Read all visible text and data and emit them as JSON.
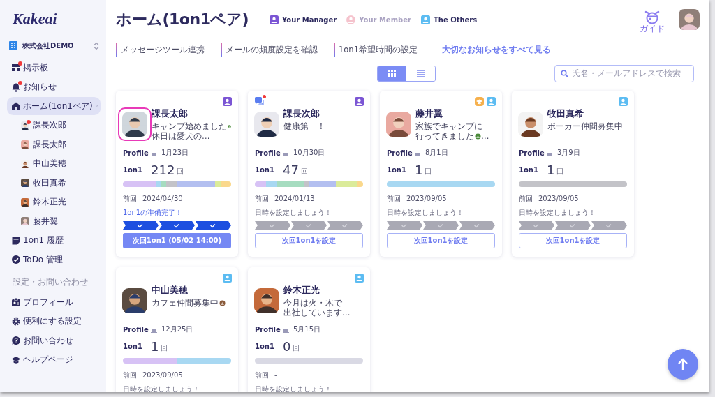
{
  "sidebar": {
    "logo": "Kakeai",
    "company": "株式会社DEMO",
    "items": [
      {
        "kind": "board",
        "label": "掲示板",
        "unread": true,
        "selected": false
      },
      {
        "kind": "bell",
        "label": "お知らせ",
        "unread": true,
        "selected": false
      },
      {
        "kind": "home",
        "label": "ホーム(1on1ペア)",
        "unread": false,
        "selected": true,
        "expanded": true,
        "children": [
          {
            "label": "課長次郎",
            "unread": true,
            "selected": false
          },
          {
            "label": "課長太郎",
            "unread": false,
            "selected": false
          },
          {
            "label": "中山美穂",
            "unread": false,
            "selected": false
          },
          {
            "label": "牧田真希",
            "unread": false,
            "selected": false
          },
          {
            "label": "鈴木正光",
            "unread": false,
            "selected": false
          },
          {
            "label": "藤井翼",
            "unread": false,
            "selected": false
          }
        ]
      },
      {
        "kind": "history",
        "label": "1on1 履歴",
        "unread": false,
        "selected": false
      },
      {
        "kind": "todo",
        "label": "ToDo 管理",
        "unread": false,
        "selected": false
      }
    ],
    "section_title": "設定・お問い合わせ",
    "settings_items": [
      {
        "kind": "profile",
        "label": "プロフィール",
        "selected": false
      },
      {
        "kind": "gear",
        "label": "便利にする設定",
        "selected": false
      },
      {
        "kind": "help",
        "label": "お問い合わせ",
        "selected": false
      },
      {
        "kind": "cap",
        "label": "ヘルプページ",
        "selected": false
      }
    ]
  },
  "header": {
    "title": "ホーム(1on1ペア)",
    "legend": [
      {
        "kind": "manager",
        "label": "Your Manager",
        "color": "#7b55d4",
        "dimmed": false
      },
      {
        "kind": "member",
        "label": "Your Member",
        "color": "#f5c3cd",
        "dimmed": true
      },
      {
        "kind": "others",
        "label": "The Others",
        "color": "#5cbcf2",
        "dimmed": false
      }
    ],
    "guide": "ガイド"
  },
  "links": [
    "メッセージツール連携",
    "メールの頻度設定を確認",
    "1on1希望時間の設定"
  ],
  "notice_link": "大切なお知らせをすべて見る",
  "view_toggle": [
    {
      "kind": "grid",
      "selected": true
    },
    {
      "kind": "list",
      "selected": false
    }
  ],
  "search": {
    "placeholder": "氏名・メールアドレスで検索"
  },
  "cards": [
    {
      "name": "課長太郎",
      "highlighted": true,
      "badges": [
        {
          "kind": "person",
          "color": "#7b55d4"
        }
      ],
      "message": [
        {
          "text": "キャンプ始めました",
          "icon": true
        },
        {
          "text": "休日は愛犬の…",
          "icon": false
        }
      ],
      "profile_label": "Profile",
      "birthday": "1月23日",
      "count_label": "1on1",
      "count": "212",
      "count_unit": "回",
      "segments": [
        {
          "color": "#d7c2f5"
        },
        {
          "color": "#d7c2f5"
        },
        {
          "color": "#d7c2f5"
        },
        {
          "color": "#d7c2f5"
        },
        {
          "color": "#d7c2f5"
        },
        {
          "color": "#d7c2f5"
        },
        {
          "color": "#a8d8f2"
        },
        {
          "color": "#a6dcc0"
        },
        {
          "color": "#c3c3c8"
        },
        {
          "color": "#c3c3c8"
        },
        {
          "color": "#b3bff0"
        },
        {
          "color": "#b3bff0"
        },
        {
          "color": "#b3bff0"
        },
        {
          "color": "#b3bff0"
        },
        {
          "color": "#b3bff0"
        },
        {
          "color": "#b3bff0"
        },
        {
          "color": "#b3bff0"
        },
        {
          "color": "#dbeb9a"
        },
        {
          "color": "#fad88c"
        },
        {
          "color": "#fad88c"
        }
      ],
      "last_label": "前回",
      "last": "2024/04/30",
      "prep": "1on1の準備完了！",
      "prep_done": true,
      "steps": [
        {
          "done": true
        },
        {
          "done": true
        },
        {
          "done": true
        }
      ],
      "button": {
        "label": "次回1on1 (05/02 14:00)",
        "kind": "primary"
      }
    },
    {
      "name": "課長次郎",
      "highlighted": false,
      "chat_unread": true,
      "badges": [
        {
          "kind": "person",
          "color": "#7b55d4"
        }
      ],
      "message": [
        {
          "text": "健康第一！",
          "icon": false
        }
      ],
      "profile_label": "Profile",
      "birthday": "10月30日",
      "count_label": "1on1",
      "count": "47",
      "count_unit": "回",
      "segments": [
        {
          "color": "#d7c2f5"
        },
        {
          "color": "#d7c2f5"
        },
        {
          "color": "#a8d8f2"
        },
        {
          "color": "#a8d8f2"
        },
        {
          "color": "#a6dcc0"
        },
        {
          "color": "#a6dcc0"
        },
        {
          "color": "#a6dcc0"
        },
        {
          "color": "#a6dcc0"
        },
        {
          "color": "#a6dcc0"
        },
        {
          "color": "#c3c3c8"
        },
        {
          "color": "#b3bff0"
        },
        {
          "color": "#b3bff0"
        },
        {
          "color": "#b3bff0"
        },
        {
          "color": "#b3bff0"
        },
        {
          "color": "#b3bff0"
        },
        {
          "color": "#dbeb9a"
        },
        {
          "color": "#dbeb9a"
        },
        {
          "color": "#dbeb9a"
        },
        {
          "color": "#dbeb9a"
        },
        {
          "color": "#fad88c"
        }
      ],
      "last_label": "前回",
      "last": "2024/01/13",
      "prep": "日時を設定しましょう！",
      "prep_done": false,
      "steps": [
        {
          "done": false
        },
        {
          "done": false
        },
        {
          "done": false
        }
      ],
      "button": {
        "label": "次回1on1を設定",
        "kind": "outline"
      }
    },
    {
      "name": "藤井翼",
      "highlighted": false,
      "badges": [
        {
          "kind": "cap",
          "color": "#f6b04c"
        },
        {
          "kind": "person",
          "color": "#5cbcf2"
        }
      ],
      "message": [
        {
          "text": "家族でキャンプに",
          "icon": false
        },
        {
          "text": "行ってきました",
          "icon": true,
          "after": "…"
        }
      ],
      "profile_label": "Profile",
      "birthday": "8月1日",
      "count_label": "1on1",
      "count": "1",
      "count_unit": "回",
      "segments": [
        {
          "color": "#a8d8f2"
        }
      ],
      "last_label": "前回",
      "last": "2023/09/05",
      "prep": "日時を設定しましょう！",
      "prep_done": false,
      "steps": [
        {
          "done": false
        },
        {
          "done": false
        },
        {
          "done": false
        }
      ],
      "button": {
        "label": "次回1on1を設定",
        "kind": "outline"
      }
    },
    {
      "name": "牧田真希",
      "highlighted": false,
      "badges": [
        {
          "kind": "person",
          "color": "#5cbcf2"
        }
      ],
      "message": [
        {
          "text": "ポーカー仲間募集中",
          "icon": false
        }
      ],
      "profile_label": "Profile",
      "birthday": "3月9日",
      "count_label": "1on1",
      "count": "1",
      "count_unit": "回",
      "segments": [
        {
          "color": "#c3c3c8"
        }
      ],
      "last_label": "前回",
      "last": "2023/09/05",
      "prep": "日時を設定しましょう！",
      "prep_done": false,
      "steps": [
        {
          "done": false
        },
        {
          "done": false
        },
        {
          "done": false
        }
      ],
      "button": {
        "label": "次回1on1を設定",
        "kind": "outline"
      }
    },
    {
      "name": "中山美穂",
      "highlighted": false,
      "badges": [
        {
          "kind": "person",
          "color": "#5cbcf2"
        }
      ],
      "message": [
        {
          "text": "カフェ仲間募集中",
          "icon": true
        }
      ],
      "profile_label": "Profile",
      "birthday": "12月25日",
      "count_label": "1on1",
      "count": "1",
      "count_unit": "回",
      "segments": [
        {
          "color": "#d7c2f5"
        },
        {
          "color": "#a8d8f2"
        }
      ],
      "last_label": "前回",
      "last": "2023/09/05",
      "prep": "日時を設定しましょう！",
      "prep_done": false
    },
    {
      "name": "鈴木正光",
      "highlighted": false,
      "badges": [
        {
          "kind": "person",
          "color": "#5cbcf2"
        }
      ],
      "message": [
        {
          "text": "今月は火・木で",
          "icon": false
        },
        {
          "text": "出社しています…",
          "icon": false
        }
      ],
      "profile_label": "Profile",
      "birthday": "5月15日",
      "count_label": "1on1",
      "count": "0",
      "count_unit": "回",
      "segments": [
        {
          "color": "#d9d9e4"
        }
      ],
      "last_label": "前回",
      "last": "-",
      "prep": "日時を設定しましょう！",
      "prep_done": false
    }
  ]
}
